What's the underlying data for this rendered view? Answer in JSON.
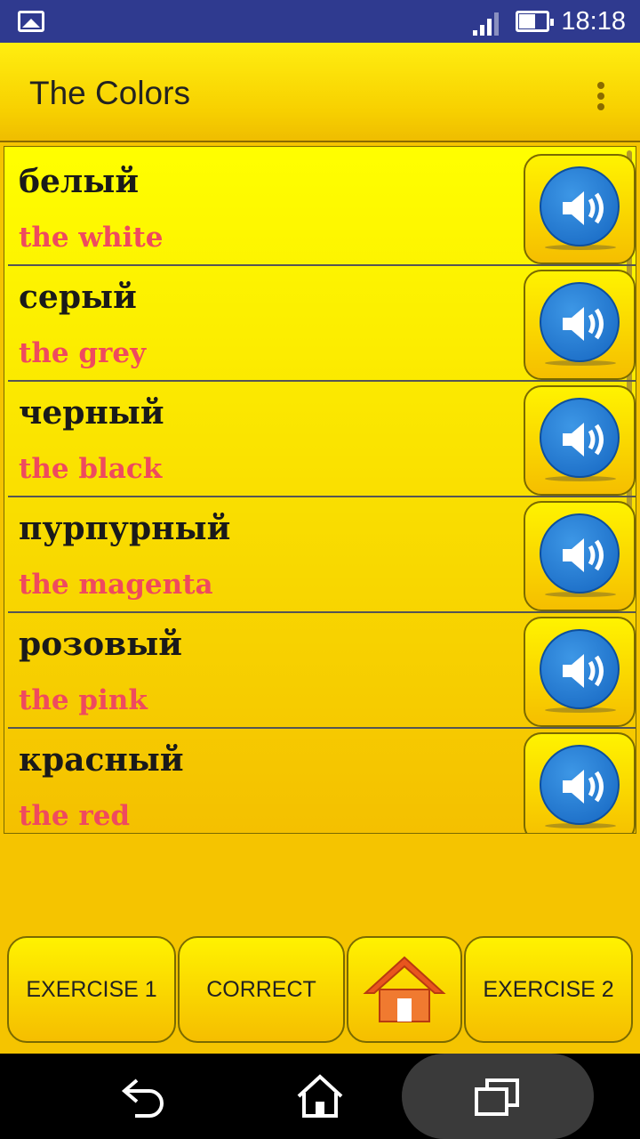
{
  "status_bar": {
    "time": "18:18",
    "icons": [
      "gallery-icon",
      "signal-icon",
      "battery-icon"
    ]
  },
  "app_bar": {
    "title": "The Colors",
    "menu_icon": "more-vert-icon"
  },
  "words": [
    {
      "ru": "белый",
      "en": "the white"
    },
    {
      "ru": "серый",
      "en": "the grey"
    },
    {
      "ru": "черный",
      "en": "the black"
    },
    {
      "ru": "пурпурный",
      "en": "the magenta"
    },
    {
      "ru": "розовый",
      "en": "the pink"
    },
    {
      "ru": "красный",
      "en": "the red"
    }
  ],
  "bottom_bar": {
    "exercise1_label": "EXERCISE 1",
    "correct_label": "CORRECT",
    "home_icon": "home-icon",
    "exercise2_label": "EXERCISE 2"
  },
  "nav_bar": {
    "icons": [
      "back-icon",
      "home-icon",
      "recents-icon"
    ]
  },
  "colors": {
    "status_bar": "#2f3a8f",
    "accent_yellow": "#ffee10",
    "english_text": "#ef4a5e",
    "speaker_blue": "#1565c0"
  }
}
